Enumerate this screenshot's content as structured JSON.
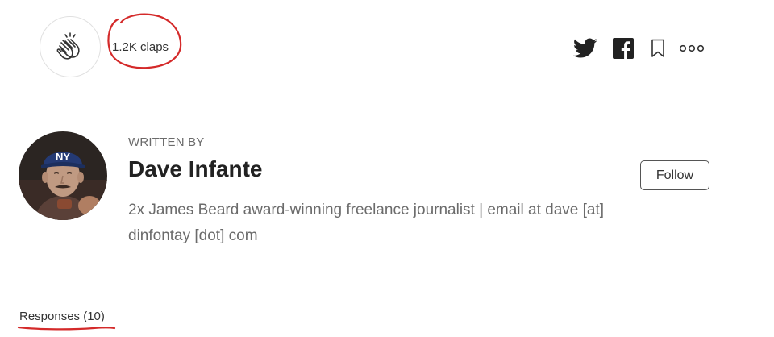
{
  "claps": {
    "count_label": "1.2K claps",
    "icon": "clap-icon"
  },
  "share": {
    "icons": [
      "twitter-icon",
      "facebook-icon",
      "bookmark-icon",
      "more-icon"
    ]
  },
  "author": {
    "written_by_label": "WRITTEN BY",
    "name": "Dave Infante",
    "cap_text": "NY",
    "bio": "2x James Beard award-winning freelance journalist | email at dave [at] dinfontay [dot] com",
    "follow_label": "Follow"
  },
  "responses": {
    "label": "Responses (10)"
  },
  "colors": {
    "annotation": "#d42a2a",
    "text": "#333333",
    "muted": "#6b6b6b",
    "divider": "#e6e6e6"
  }
}
